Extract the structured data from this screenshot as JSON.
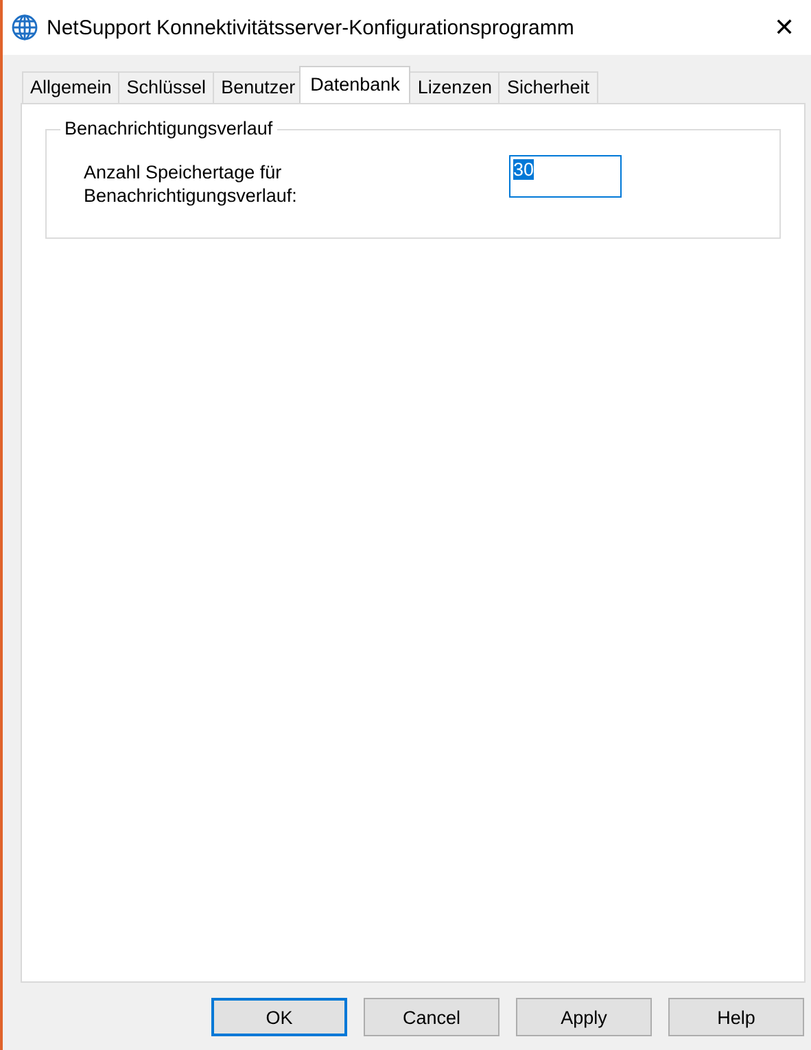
{
  "window": {
    "title": "NetSupport Konnektivitätsserver-Konfigurationsprogramm",
    "close": "✕"
  },
  "tabs": [
    {
      "label": "Allgemein",
      "selected": false
    },
    {
      "label": "Schlüssel",
      "selected": false
    },
    {
      "label": "Benutzer",
      "selected": false
    },
    {
      "label": "Datenbank",
      "selected": true
    },
    {
      "label": "Lizenzen",
      "selected": false
    },
    {
      "label": "Sicherheit",
      "selected": false
    }
  ],
  "group": {
    "title": "Benachrichtigungsverlauf",
    "label": "Anzahl Speichertage für\nBenachrichtigungsverlauf:",
    "value": "30",
    "focused": true
  },
  "buttons": [
    {
      "label": "OK",
      "default": true
    },
    {
      "label": "Cancel",
      "default": false
    },
    {
      "label": "Apply",
      "default": false
    },
    {
      "label": "Help",
      "default": false
    }
  ]
}
